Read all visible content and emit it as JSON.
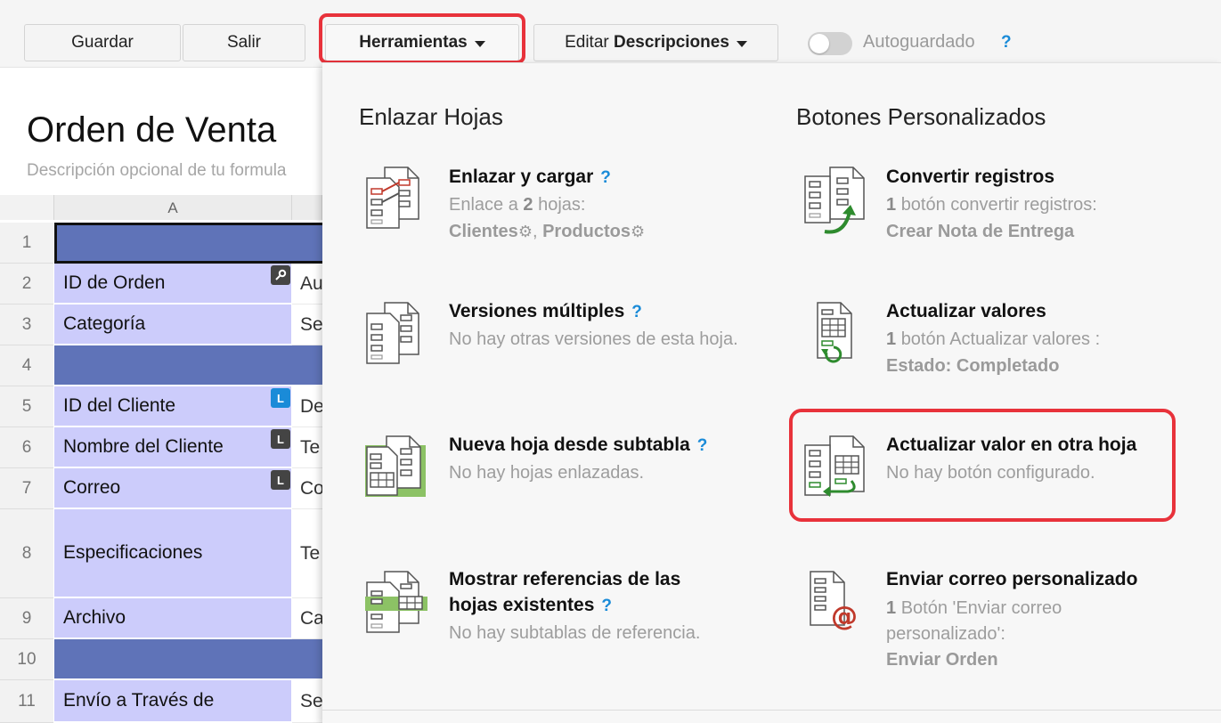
{
  "toolbar": {
    "save_label": "Guardar",
    "exit_label": "Salir",
    "tools_label": "Herramientas",
    "edit_prefix": "Editar",
    "edit_bold": "Descripciones",
    "autosave_label": "Autoguardado",
    "help_mark": "?"
  },
  "form": {
    "title": "Orden de Venta",
    "description": "Descripción opcional de tu formula",
    "column_a": "A"
  },
  "rows": [
    {
      "num": "1"
    },
    {
      "num": "2",
      "label": "ID de Orden",
      "value": "Au"
    },
    {
      "num": "3",
      "label": "Categoría",
      "value": "Se"
    },
    {
      "num": "4"
    },
    {
      "num": "5",
      "label": "ID del Cliente",
      "value": "De",
      "badge": "L"
    },
    {
      "num": "6",
      "label": "Nombre del Cliente",
      "value": "Te",
      "badge": "L"
    },
    {
      "num": "7",
      "label": "Correo",
      "value": "Co",
      "badge": "L"
    },
    {
      "num": "8",
      "label": "Especificaciones",
      "value": "Te"
    },
    {
      "num": "9",
      "label": "Archivo",
      "value": "Ca"
    },
    {
      "num": "10"
    },
    {
      "num": "11",
      "label": "Envío a Través de",
      "value": "Se"
    }
  ],
  "menu": {
    "left_heading": "Enlazar Hojas",
    "right_heading": "Botones Personalizados",
    "left_items": [
      {
        "title": "Enlazar y cargar",
        "desc_prefix": "Enlace a",
        "desc_count": "2",
        "desc_suffix": "hojas:",
        "link1": "Clientes",
        "link_sep": ",",
        "link2": "Productos",
        "help": "?"
      },
      {
        "title": "Versiones múltiples",
        "desc": "No hay otras versiones de esta hoja.",
        "help": "?"
      },
      {
        "title": "Nueva hoja desde subtabla",
        "desc": "No hay hojas enlazadas.",
        "help": "?"
      },
      {
        "title_line1": "Mostrar referencias de las",
        "title_line2": "hojas existentes",
        "desc": "No hay subtablas de referencia.",
        "help": "?"
      }
    ],
    "right_items": [
      {
        "title": "Convertir registros",
        "count": "1",
        "desc": "botón convertir registros:",
        "detail": "Crear Nota de Entrega"
      },
      {
        "title": "Actualizar valores",
        "count": "1",
        "desc": "botón Actualizar valores :",
        "detail": "Estado: Completado"
      },
      {
        "title": "Actualizar valor en otra hoja",
        "desc": "No hay botón configurado."
      },
      {
        "title": "Enviar correo personalizado",
        "count": "1",
        "desc_line1": "Botón 'Enviar correo",
        "desc_line2": "personalizado':",
        "detail": "Enviar Orden"
      }
    ]
  },
  "colors": {
    "highlight": "#e8323b",
    "section": "#5f73b8",
    "label_cell": "#ccccfb",
    "help": "#1a8bd8"
  }
}
